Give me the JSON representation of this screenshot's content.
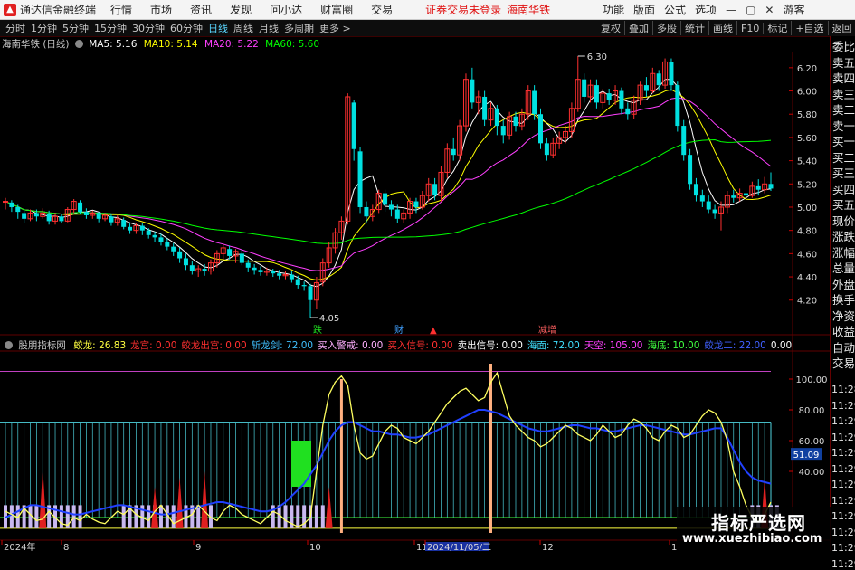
{
  "titlebar": {
    "app_name": "通达信金融终端",
    "menus": [
      "行情",
      "市场",
      "资讯",
      "发现",
      "问小达",
      "财富圈",
      "交易"
    ],
    "warning": "证券交易未登录",
    "stock_name": "海南华铁",
    "right_items": [
      "功能",
      "版面",
      "公式",
      "选项"
    ],
    "user": "游客"
  },
  "toolbar": {
    "periods": [
      "分时",
      "1分钟",
      "5分钟",
      "15分钟",
      "30分钟",
      "60分钟",
      "日线",
      "周线",
      "月线",
      "多周期",
      "更多 >"
    ],
    "active_period": "日线",
    "right_buttons": [
      "复权",
      "叠加",
      "多股",
      "统计",
      "画线",
      "F10",
      "标记",
      "+自选",
      "返回"
    ]
  },
  "main_chart": {
    "stock_label": "海南华铁 (日线)",
    "ma_labels": [
      {
        "text": "MA5: 5.16",
        "color": "#ffffff"
      },
      {
        "text": "MA10: 5.14",
        "color": "#ffff00"
      },
      {
        "text": "MA20: 5.22",
        "color": "#ff40ff"
      },
      {
        "text": "MA60: 5.60",
        "color": "#00ff00"
      }
    ],
    "price_ticks": [
      "6.20",
      "6.00",
      "5.80",
      "5.60",
      "5.40",
      "5.20",
      "5.00",
      "4.80",
      "4.60",
      "4.40",
      "4.20"
    ],
    "high_label": "6.30",
    "low_label": "4.05",
    "event_labels": [
      {
        "text": "跌",
        "color": "#20e020"
      },
      {
        "text": "财",
        "color": "#40a0ff"
      },
      {
        "text": "▲",
        "color": "#ff3030"
      },
      {
        "text": "减增",
        "color": "#ff6060"
      }
    ]
  },
  "indicator": {
    "name": "股朋指标网",
    "values": [
      {
        "text": "蛟龙: 26.83",
        "color": "#ffff40"
      },
      {
        "text": "龙宫: 0.00",
        "color": "#ff3030"
      },
      {
        "text": "蛟龙出宫: 0.00",
        "color": "#ff3030"
      },
      {
        "text": "斩龙剑: 72.00",
        "color": "#40c0ff"
      },
      {
        "text": "买入警戒: 0.00",
        "color": "#ffb0ff"
      },
      {
        "text": "买入信号: 0.00",
        "color": "#ff3030"
      },
      {
        "text": "卖出信号: 0.00",
        "color": "#ffffff"
      },
      {
        "text": "海面: 72.00",
        "color": "#40e0ff"
      },
      {
        "text": "天空: 105.00",
        "color": "#ff40ff"
      },
      {
        "text": "海底: 10.00",
        "color": "#40ff40"
      },
      {
        "text": "蛟龙二: 22.00",
        "color": "#4060ff"
      },
      {
        "text": "0.00",
        "color": "#ffffff"
      }
    ],
    "y_ticks": [
      "100.00",
      "80.00",
      "60.00",
      "40.00"
    ],
    "current_value": "51.09"
  },
  "date_axis": {
    "labels": [
      "2024年",
      "8",
      "9",
      "10",
      "11",
      "2024/11/05/二",
      "12",
      "1"
    ]
  },
  "right_panel": {
    "labels": [
      "委比",
      "卖五",
      "卖四",
      "卖三",
      "卖二",
      "卖一",
      "买一",
      "买二",
      "买三",
      "买四",
      "买五",
      "现价",
      "涨跌",
      "涨幅",
      "总量",
      "外盘",
      "换手",
      "净资",
      "收益",
      "自动",
      "交易"
    ],
    "times": [
      "11:28",
      "11:29",
      "11:29",
      "11:29",
      "11:29",
      "11:29",
      "11:29",
      "11:29",
      "11:29",
      "11:29",
      "11:29",
      "11:29"
    ],
    "top_marks": [
      "0",
      "100"
    ]
  },
  "watermark": {
    "title": "指标严选网",
    "url": "www.xuezhibiao.com"
  },
  "colors": {
    "up": "#ff3030",
    "down": "#00e0e0",
    "ma5": "#ffffff",
    "ma10": "#ffff00",
    "ma20": "#ff40ff",
    "ma60": "#00ff00",
    "grid": "#600000"
  },
  "chart_data": {
    "type": "candlestick",
    "y_range": [
      4.05,
      6.3
    ],
    "candles": [
      [
        5.05,
        5.05,
        5.08,
        4.98
      ],
      [
        5.04,
        5.0,
        5.06,
        4.96
      ],
      [
        5.0,
        4.96,
        5.02,
        4.9
      ],
      [
        4.95,
        4.9,
        4.97,
        4.86
      ],
      [
        4.9,
        4.95,
        4.98,
        4.88
      ],
      [
        4.95,
        4.92,
        4.98,
        4.88
      ],
      [
        4.92,
        4.95,
        4.99,
        4.9
      ],
      [
        4.94,
        4.88,
        4.97,
        4.85
      ],
      [
        4.88,
        4.92,
        4.95,
        4.85
      ],
      [
        4.92,
        4.88,
        4.94,
        4.86
      ],
      [
        4.88,
        4.98,
        5.0,
        4.87
      ],
      [
        4.98,
        5.05,
        5.07,
        4.95
      ],
      [
        5.04,
        4.96,
        5.06,
        4.94
      ],
      [
        4.96,
        4.93,
        4.99,
        4.9
      ],
      [
        4.93,
        4.95,
        4.97,
        4.9
      ],
      [
        4.95,
        4.9,
        4.96,
        4.87
      ],
      [
        4.9,
        4.93,
        4.95,
        4.88
      ],
      [
        4.92,
        4.87,
        4.94,
        4.84
      ],
      [
        4.87,
        4.9,
        4.93,
        4.84
      ],
      [
        4.89,
        4.83,
        4.91,
        4.81
      ],
      [
        4.83,
        4.8,
        4.86,
        4.77
      ],
      [
        4.8,
        4.84,
        4.86,
        4.77
      ],
      [
        4.84,
        4.8,
        4.86,
        4.76
      ],
      [
        4.8,
        4.76,
        4.82,
        4.73
      ],
      [
        4.76,
        4.74,
        4.79,
        4.7
      ],
      [
        4.74,
        4.7,
        4.77,
        4.67
      ],
      [
        4.7,
        4.66,
        4.73,
        4.63
      ],
      [
        4.66,
        4.62,
        4.69,
        4.58
      ],
      [
        4.62,
        4.56,
        4.65,
        4.52
      ],
      [
        4.56,
        4.5,
        4.6,
        4.46
      ],
      [
        4.5,
        4.45,
        4.54,
        4.42
      ],
      [
        4.45,
        4.47,
        4.5,
        4.4
      ],
      [
        4.47,
        4.45,
        4.51,
        4.41
      ],
      [
        4.45,
        4.52,
        4.55,
        4.42
      ],
      [
        4.52,
        4.6,
        4.63,
        4.48
      ],
      [
        4.6,
        4.65,
        4.68,
        4.55
      ],
      [
        4.64,
        4.58,
        4.67,
        4.55
      ],
      [
        4.58,
        4.62,
        4.64,
        4.52
      ],
      [
        4.6,
        4.52,
        4.64,
        4.5
      ],
      [
        4.52,
        4.48,
        4.55,
        4.44
      ],
      [
        4.48,
        4.46,
        4.51,
        4.42
      ],
      [
        4.46,
        4.44,
        4.49,
        4.41
      ],
      [
        4.44,
        4.45,
        4.48,
        4.41
      ],
      [
        4.45,
        4.43,
        4.47,
        4.4
      ],
      [
        4.43,
        4.41,
        4.46,
        4.38
      ],
      [
        4.41,
        4.42,
        4.45,
        4.38
      ],
      [
        4.42,
        4.38,
        4.45,
        4.35
      ],
      [
        4.38,
        4.33,
        4.41,
        4.3
      ],
      [
        4.33,
        4.32,
        4.36,
        4.28
      ],
      [
        4.32,
        4.2,
        4.34,
        4.05
      ],
      [
        4.2,
        4.35,
        4.4,
        4.12
      ],
      [
        4.36,
        4.52,
        4.56,
        4.32
      ],
      [
        4.52,
        4.65,
        4.7,
        4.48
      ],
      [
        4.65,
        4.78,
        4.82,
        4.6
      ],
      [
        4.78,
        4.88,
        4.92,
        4.72
      ],
      [
        4.88,
        5.95,
        5.98,
        4.85
      ],
      [
        5.9,
        5.5,
        5.92,
        5.4
      ],
      [
        5.48,
        5.0,
        5.52,
        4.95
      ],
      [
        5.0,
        4.92,
        5.05,
        4.86
      ],
      [
        4.92,
        4.98,
        5.02,
        4.88
      ],
      [
        4.98,
        5.12,
        5.15,
        4.95
      ],
      [
        5.12,
        5.02,
        5.15,
        4.96
      ],
      [
        5.02,
        4.98,
        5.06,
        4.92
      ],
      [
        4.98,
        4.9,
        5.02,
        4.86
      ],
      [
        4.9,
        4.95,
        4.98,
        4.86
      ],
      [
        4.95,
        5.05,
        5.08,
        4.9
      ],
      [
        5.05,
        5.0,
        5.08,
        4.95
      ],
      [
        5.0,
        5.1,
        5.14,
        4.98
      ],
      [
        5.1,
        5.2,
        5.25,
        5.05
      ],
      [
        5.2,
        5.1,
        5.25,
        5.06
      ],
      [
        5.1,
        5.3,
        5.35,
        5.05
      ],
      [
        5.3,
        5.5,
        5.55,
        5.25
      ],
      [
        5.5,
        5.45,
        5.6,
        5.4
      ],
      [
        5.45,
        5.7,
        5.75,
        5.4
      ],
      [
        5.7,
        6.1,
        6.15,
        5.65
      ],
      [
        6.1,
        5.9,
        6.2,
        5.85
      ],
      [
        5.9,
        5.95,
        6.0,
        5.8
      ],
      [
        5.95,
        5.75,
        6.0,
        5.7
      ],
      [
        5.75,
        5.85,
        5.9,
        5.7
      ],
      [
        5.85,
        5.7,
        5.88,
        5.62
      ],
      [
        5.7,
        5.62,
        5.75,
        5.55
      ],
      [
        5.62,
        5.78,
        5.82,
        5.58
      ],
      [
        5.78,
        5.7,
        5.82,
        5.65
      ],
      [
        5.7,
        5.8,
        5.85,
        5.66
      ],
      [
        5.8,
        6.0,
        6.05,
        5.75
      ],
      [
        6.0,
        5.8,
        6.05,
        5.75
      ],
      [
        5.8,
        5.55,
        5.85,
        5.5
      ],
      [
        5.55,
        5.45,
        5.6,
        5.4
      ],
      [
        5.45,
        5.55,
        5.6,
        5.42
      ],
      [
        5.55,
        5.6,
        5.65,
        5.5
      ],
      [
        5.6,
        5.65,
        5.7,
        5.55
      ],
      [
        5.65,
        5.85,
        5.9,
        5.6
      ],
      [
        5.85,
        6.1,
        6.3,
        5.82
      ],
      [
        6.1,
        5.95,
        6.15,
        5.9
      ],
      [
        5.95,
        6.05,
        6.1,
        5.9
      ],
      [
        6.05,
        5.9,
        6.1,
        5.85
      ],
      [
        5.9,
        5.98,
        6.02,
        5.85
      ],
      [
        5.98,
        5.92,
        6.02,
        5.88
      ],
      [
        5.92,
        6.0,
        6.05,
        5.88
      ],
      [
        6.0,
        5.85,
        6.03,
        5.8
      ],
      [
        5.85,
        5.8,
        5.9,
        5.75
      ],
      [
        5.8,
        5.92,
        5.96,
        5.76
      ],
      [
        5.92,
        6.05,
        6.08,
        5.88
      ],
      [
        6.05,
        6.0,
        6.12,
        5.95
      ],
      [
        6.0,
        6.15,
        6.2,
        5.98
      ],
      [
        6.15,
        6.05,
        6.18,
        6.0
      ],
      [
        6.05,
        6.25,
        6.28,
        6.02
      ],
      [
        6.25,
        6.05,
        6.28,
        6.0
      ],
      [
        6.05,
        5.7,
        6.08,
        5.65
      ],
      [
        5.7,
        5.45,
        5.75,
        5.4
      ],
      [
        5.45,
        5.2,
        5.5,
        5.15
      ],
      [
        5.2,
        5.1,
        5.25,
        5.05
      ],
      [
        5.1,
        5.05,
        5.15,
        5.0
      ],
      [
        5.05,
        4.98,
        5.1,
        4.95
      ],
      [
        4.98,
        4.95,
        5.02,
        4.9
      ],
      [
        4.95,
        5.0,
        5.05,
        4.8
      ],
      [
        5.0,
        5.1,
        5.14,
        4.95
      ],
      [
        5.1,
        5.08,
        5.15,
        5.04
      ],
      [
        5.08,
        5.12,
        5.16,
        5.05
      ],
      [
        5.12,
        5.1,
        5.18,
        5.08
      ],
      [
        5.1,
        5.18,
        5.22,
        5.08
      ],
      [
        5.18,
        5.15,
        5.24,
        5.1
      ],
      [
        5.15,
        5.2,
        5.26,
        5.12
      ],
      [
        5.2,
        5.16,
        5.3,
        5.14
      ]
    ]
  }
}
